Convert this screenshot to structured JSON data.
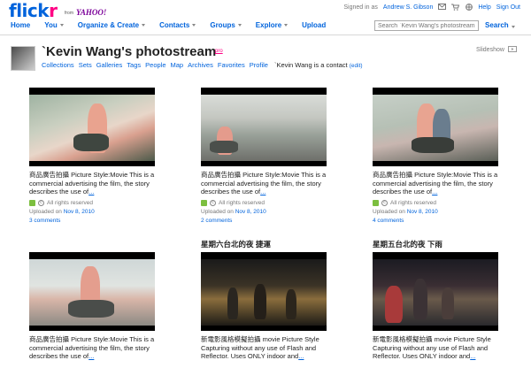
{
  "header": {
    "logo_main": "flick",
    "logo_r": "r",
    "logo_from": "from",
    "logo_yahoo": "YAHOO!",
    "signed_in_prefix": "Signed in as",
    "username": "Andrew S. Gibson",
    "help": "Help",
    "sign_out": "Sign Out"
  },
  "nav": {
    "items": [
      "Home",
      "You",
      "Organize & Create",
      "Contacts",
      "Groups",
      "Explore",
      "Upload"
    ],
    "search_placeholder": "Search `Kevin Wang's photostream",
    "search_button": "Search"
  },
  "photostream": {
    "title": "`Kevin Wang's photostream",
    "pro_badge": "pro",
    "slideshow": "Slideshow",
    "subnav": [
      "Collections",
      "Sets",
      "Galleries",
      "Tags",
      "People",
      "Map",
      "Archives",
      "Favorites",
      "Profile"
    ],
    "contact_note": "`Kevin Wang is a contact",
    "edit_label": "(edit)"
  },
  "photos": [
    {
      "title": "",
      "description": "商品廣告拍攝 Picture Style:Movie This is a commercial advertising the film, the story describes the use of",
      "more": "...",
      "rights": "All rights reserved",
      "uploaded_prefix": "Uploaded on",
      "uploaded_date": "Nov 8, 2010",
      "comments": "3 comments"
    },
    {
      "title": "",
      "description": "商品廣告拍攝 Picture Style:Movie This is a commercial advertising the film, the story describes the use of",
      "more": "...",
      "rights": "All rights reserved",
      "uploaded_prefix": "Uploaded on",
      "uploaded_date": "Nov 8, 2010",
      "comments": "2 comments"
    },
    {
      "title": "",
      "description": "商品廣告拍攝 Picture Style:Movie This is a commercial advertising the film, the story describes the use of",
      "more": "...",
      "rights": "All rights reserved",
      "uploaded_prefix": "Uploaded on",
      "uploaded_date": "Nov 8, 2010",
      "comments": "4 comments"
    },
    {
      "title": "",
      "description": "商品廣告拍攝 Picture Style:Movie This is a commercial advertising the film, the story describes the use of",
      "more": "..."
    },
    {
      "title": "星期六台北的夜 捷運",
      "description": "新電影風格模擬拍攝 movie Picture Style Capturing without any use of Flash and Reflector. Uses ONLY indoor and",
      "more": "..."
    },
    {
      "title": "星期五台北的夜 下雨",
      "description": "新電影風格模擬拍攝 movie Picture Style Capturing without any use of Flash and Reflector. Uses ONLY indoor and",
      "more": "..."
    }
  ],
  "colors": {
    "link_blue": "#0063dc",
    "flickr_pink": "#ff0084",
    "cc_green": "#7cbf3f"
  }
}
